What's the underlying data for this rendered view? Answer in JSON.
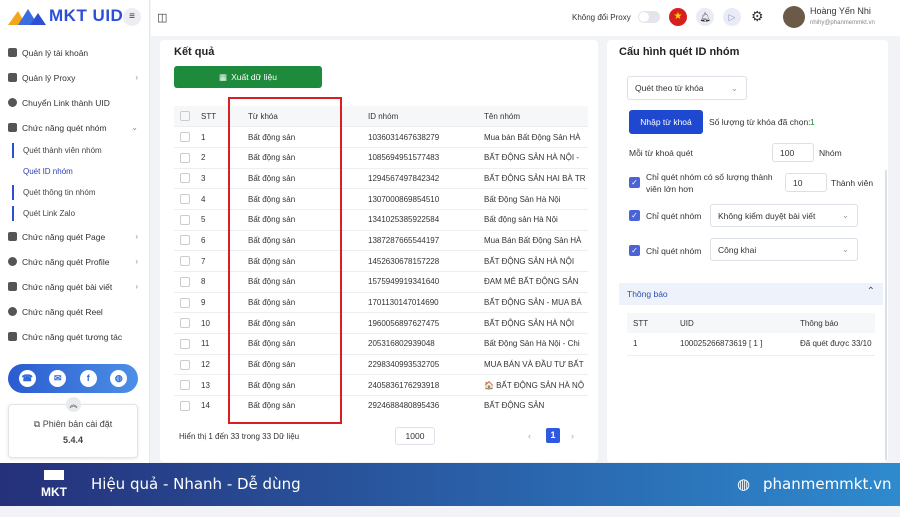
{
  "app": {
    "logo_text": "MKT UID",
    "menu_icon": "hamburger-icon"
  },
  "sidebar": {
    "items": [
      {
        "label": "Quản lý tài khoản",
        "icon": "grid-icon",
        "chevron": ""
      },
      {
        "label": "Quản lý Proxy",
        "icon": "layers-icon",
        "chevron": "›"
      },
      {
        "label": "Chuyển Link thành UID",
        "icon": "link-icon",
        "chevron": ""
      },
      {
        "label": "Chức năng quét nhóm",
        "icon": "group-icon",
        "chevron": "⌄"
      }
    ],
    "subitems": [
      {
        "label": "Quét thành viên nhóm"
      },
      {
        "label": "Quét ID nhóm"
      },
      {
        "label": "Quét thông tin nhóm"
      },
      {
        "label": "Quét Link Zalo"
      }
    ],
    "items2": [
      {
        "label": "Chức năng quét Page",
        "chevron": "›"
      },
      {
        "label": "Chức năng quét Profile",
        "chevron": "›"
      },
      {
        "label": "Chức năng quét bài viết",
        "chevron": "›"
      },
      {
        "label": "Chức năng quét Reel",
        "chevron": ""
      },
      {
        "label": "Chức năng quét tương tác",
        "chevron": ""
      }
    ],
    "version_label": "Phiên bản cài đặt",
    "version": "5.4.4"
  },
  "topbar": {
    "proxy_label": "Không đổi Proxy",
    "user_name": "Hoàng Yến Nhi",
    "user_email": "nhihy@phanmemmkt.vn"
  },
  "results": {
    "title": "Kết quả",
    "export_label": "Xuất dữ liệu",
    "columns": [
      "STT",
      "Từ khóa",
      "ID nhóm",
      "Tên nhóm"
    ],
    "rows": [
      [
        "1",
        "Bất động sản",
        "1036031467638279",
        "Mua bán Bất Động Sản HÀ"
      ],
      [
        "2",
        "Bất động sản",
        "1085694951577483",
        "BẤT ĐỘNG SẢN HÀ NỘI -"
      ],
      [
        "3",
        "Bất động sản",
        "1294567497842342",
        "BẤT ĐỘNG SẢN HAI BÀ TR"
      ],
      [
        "4",
        "Bất động sản",
        "1307000869854510",
        "Bất Động Sản Hà Nội"
      ],
      [
        "5",
        "Bất động sản",
        "1341025385922584",
        "Bất động sản Hà Nội"
      ],
      [
        "6",
        "Bất động sản",
        "1387287665544197",
        "Mua Bán Bất Động Sản HÀ"
      ],
      [
        "7",
        "Bất động sản",
        "1452630678157228",
        "BẤT ĐỘNG SẢN HÀ NỘI"
      ],
      [
        "8",
        "Bất động sản",
        "1575949919341640",
        "ĐAM MÊ BẤT ĐỘNG SẢN"
      ],
      [
        "9",
        "Bất động sản",
        "1701130147014690",
        "BẤT ĐỘNG SẢN - MUA BÁ"
      ],
      [
        "10",
        "Bất động sản",
        "1960056897627475",
        "BẤT ĐỘNG SẢN HÀ NỘI"
      ],
      [
        "11",
        "Bất động sản",
        "205316802939048",
        "Bất Động Sản Hà Nội - Chi"
      ],
      [
        "12",
        "Bất động sản",
        "2298340993532705",
        "MUA BÁN VÀ ĐẦU TƯ BẤT"
      ],
      [
        "13",
        "Bất động sản",
        "2405836176293918",
        "🏠 BẤT ĐỘNG SẢN HÀ NỘ"
      ],
      [
        "14",
        "Bất động sản",
        "2924688480895436",
        "BẤT ĐỘNG SẢN"
      ]
    ],
    "summary": "Hiển thị 1 đến 33 trong 33 Dữ liệu",
    "page_size": "1000",
    "page_prev": "‹",
    "page_current": "1",
    "page_next": "›"
  },
  "config": {
    "title": "Cấu hình quét ID nhóm",
    "mode": "Quét theo từ khóa",
    "import_label": "Nhập từ khoá",
    "count_label": "Số lượng từ khóa đã chọn:",
    "count_value": "1",
    "per_keyword_label": "Mỗi từ khoá quét",
    "per_keyword_value": "100",
    "per_keyword_unit": "Nhóm",
    "members_label": "Chỉ quét nhóm có số lượng thành viên lớn hơn",
    "members_value": "10",
    "members_unit": "Thành viên",
    "only_label": "Chỉ quét nhóm",
    "filter1": "Không kiểm duyệt bài viết",
    "filter2": "Công khai"
  },
  "notify": {
    "title": "Thông báo",
    "columns": [
      "STT",
      "UID",
      "Thông báo"
    ],
    "rows": [
      [
        "1",
        "100025266873619 [ 1 ]",
        "Đã quét được 33/10"
      ]
    ]
  },
  "footer": {
    "slogan": "Hiệu quả - Nhanh - Dễ dùng",
    "website": "phanmemmkt.vn",
    "logo_text": "MKT"
  }
}
